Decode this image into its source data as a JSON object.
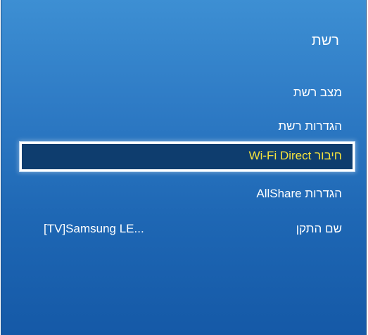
{
  "panel": {
    "title": "רשת"
  },
  "menu": {
    "items": [
      {
        "label": "מצב רשת"
      },
      {
        "label": "הגדרות רשת"
      },
      {
        "label": "חיבור Wi-Fi Direct",
        "selected": true
      },
      {
        "label": "הגדרות AllShare"
      },
      {
        "label": "שם התקן",
        "value": "[TV]Samsung LE..."
      }
    ]
  },
  "colors": {
    "panel_top": "#3d8fd3",
    "panel_bottom": "#1559a7",
    "selected_bg": "#0e3d6e",
    "selected_text": "#f6e33c",
    "text": "#ffffff"
  }
}
